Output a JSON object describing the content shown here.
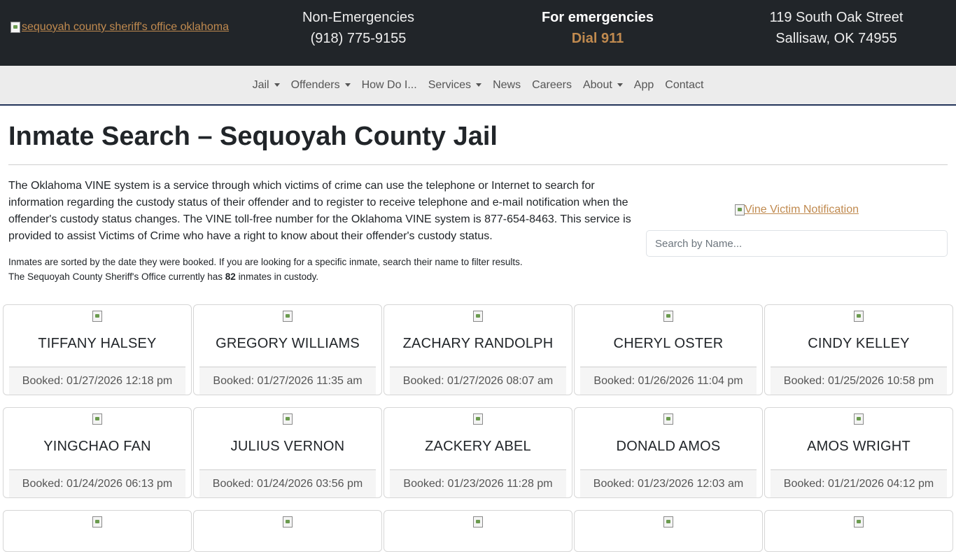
{
  "header": {
    "logo_alt": "sequoyah county sheriff's office oklahoma",
    "non_emergency_label": "Non-Emergencies",
    "non_emergency_phone": "(918) 775-9155",
    "emergency_label": "For emergencies",
    "emergency_action": "Dial 911",
    "address_line1": "119 South Oak Street",
    "address_line2": "Sallisaw, OK 74955"
  },
  "nav": {
    "items": [
      {
        "label": "Jail",
        "dropdown": true
      },
      {
        "label": "Offenders",
        "dropdown": true
      },
      {
        "label": "How Do I...",
        "dropdown": false
      },
      {
        "label": "Services",
        "dropdown": true
      },
      {
        "label": "News",
        "dropdown": false
      },
      {
        "label": "Careers",
        "dropdown": false
      },
      {
        "label": "About",
        "dropdown": true
      },
      {
        "label": "App",
        "dropdown": false
      },
      {
        "label": "Contact",
        "dropdown": false
      }
    ]
  },
  "page": {
    "title": "Inmate Search – Sequoyah County Jail",
    "intro": "The Oklahoma VINE system is a service through which victims of crime can use the telephone or Internet to search for information regarding the custody status of their offender and to register to receive telephone and e-mail notification when the offender's custody status changes. The VINE toll-free number for the Oklahoma VINE system is 877-654-8463. This service is provided to assist Victims of Crime who have a right to know about their offender's custody status.",
    "sort_note": "Inmates are sorted by the date they were booked. If you are looking for a specific inmate, search their name to filter results.",
    "count_prefix": "The Sequoyah County Sheriff's Office currently has",
    "count": "82",
    "count_suffix": "inmates in custody.",
    "vine_alt": "Vine Victim Notification",
    "search_placeholder": "Search by Name..."
  },
  "inmates": [
    {
      "name": "TIFFANY HALSEY",
      "booked": "Booked: 01/27/2026 12:18 pm"
    },
    {
      "name": "GREGORY WILLIAMS",
      "booked": "Booked: 01/27/2026 11:35 am"
    },
    {
      "name": "ZACHARY RANDOLPH",
      "booked": "Booked: 01/27/2026 08:07 am"
    },
    {
      "name": "CHERYL OSTER",
      "booked": "Booked: 01/26/2026 11:04 pm"
    },
    {
      "name": "CINDY KELLEY",
      "booked": "Booked: 01/25/2026 10:58 pm"
    },
    {
      "name": "YINGCHAO FAN",
      "booked": "Booked: 01/24/2026 06:13 pm"
    },
    {
      "name": "JULIUS VERNON",
      "booked": "Booked: 01/24/2026 03:56 pm"
    },
    {
      "name": "ZACKERY ABEL",
      "booked": "Booked: 01/23/2026 11:28 pm"
    },
    {
      "name": "DONALD AMOS",
      "booked": "Booked: 01/23/2026 12:03 am"
    },
    {
      "name": "AMOS WRIGHT",
      "booked": "Booked: 01/21/2026 04:12 pm"
    }
  ]
}
